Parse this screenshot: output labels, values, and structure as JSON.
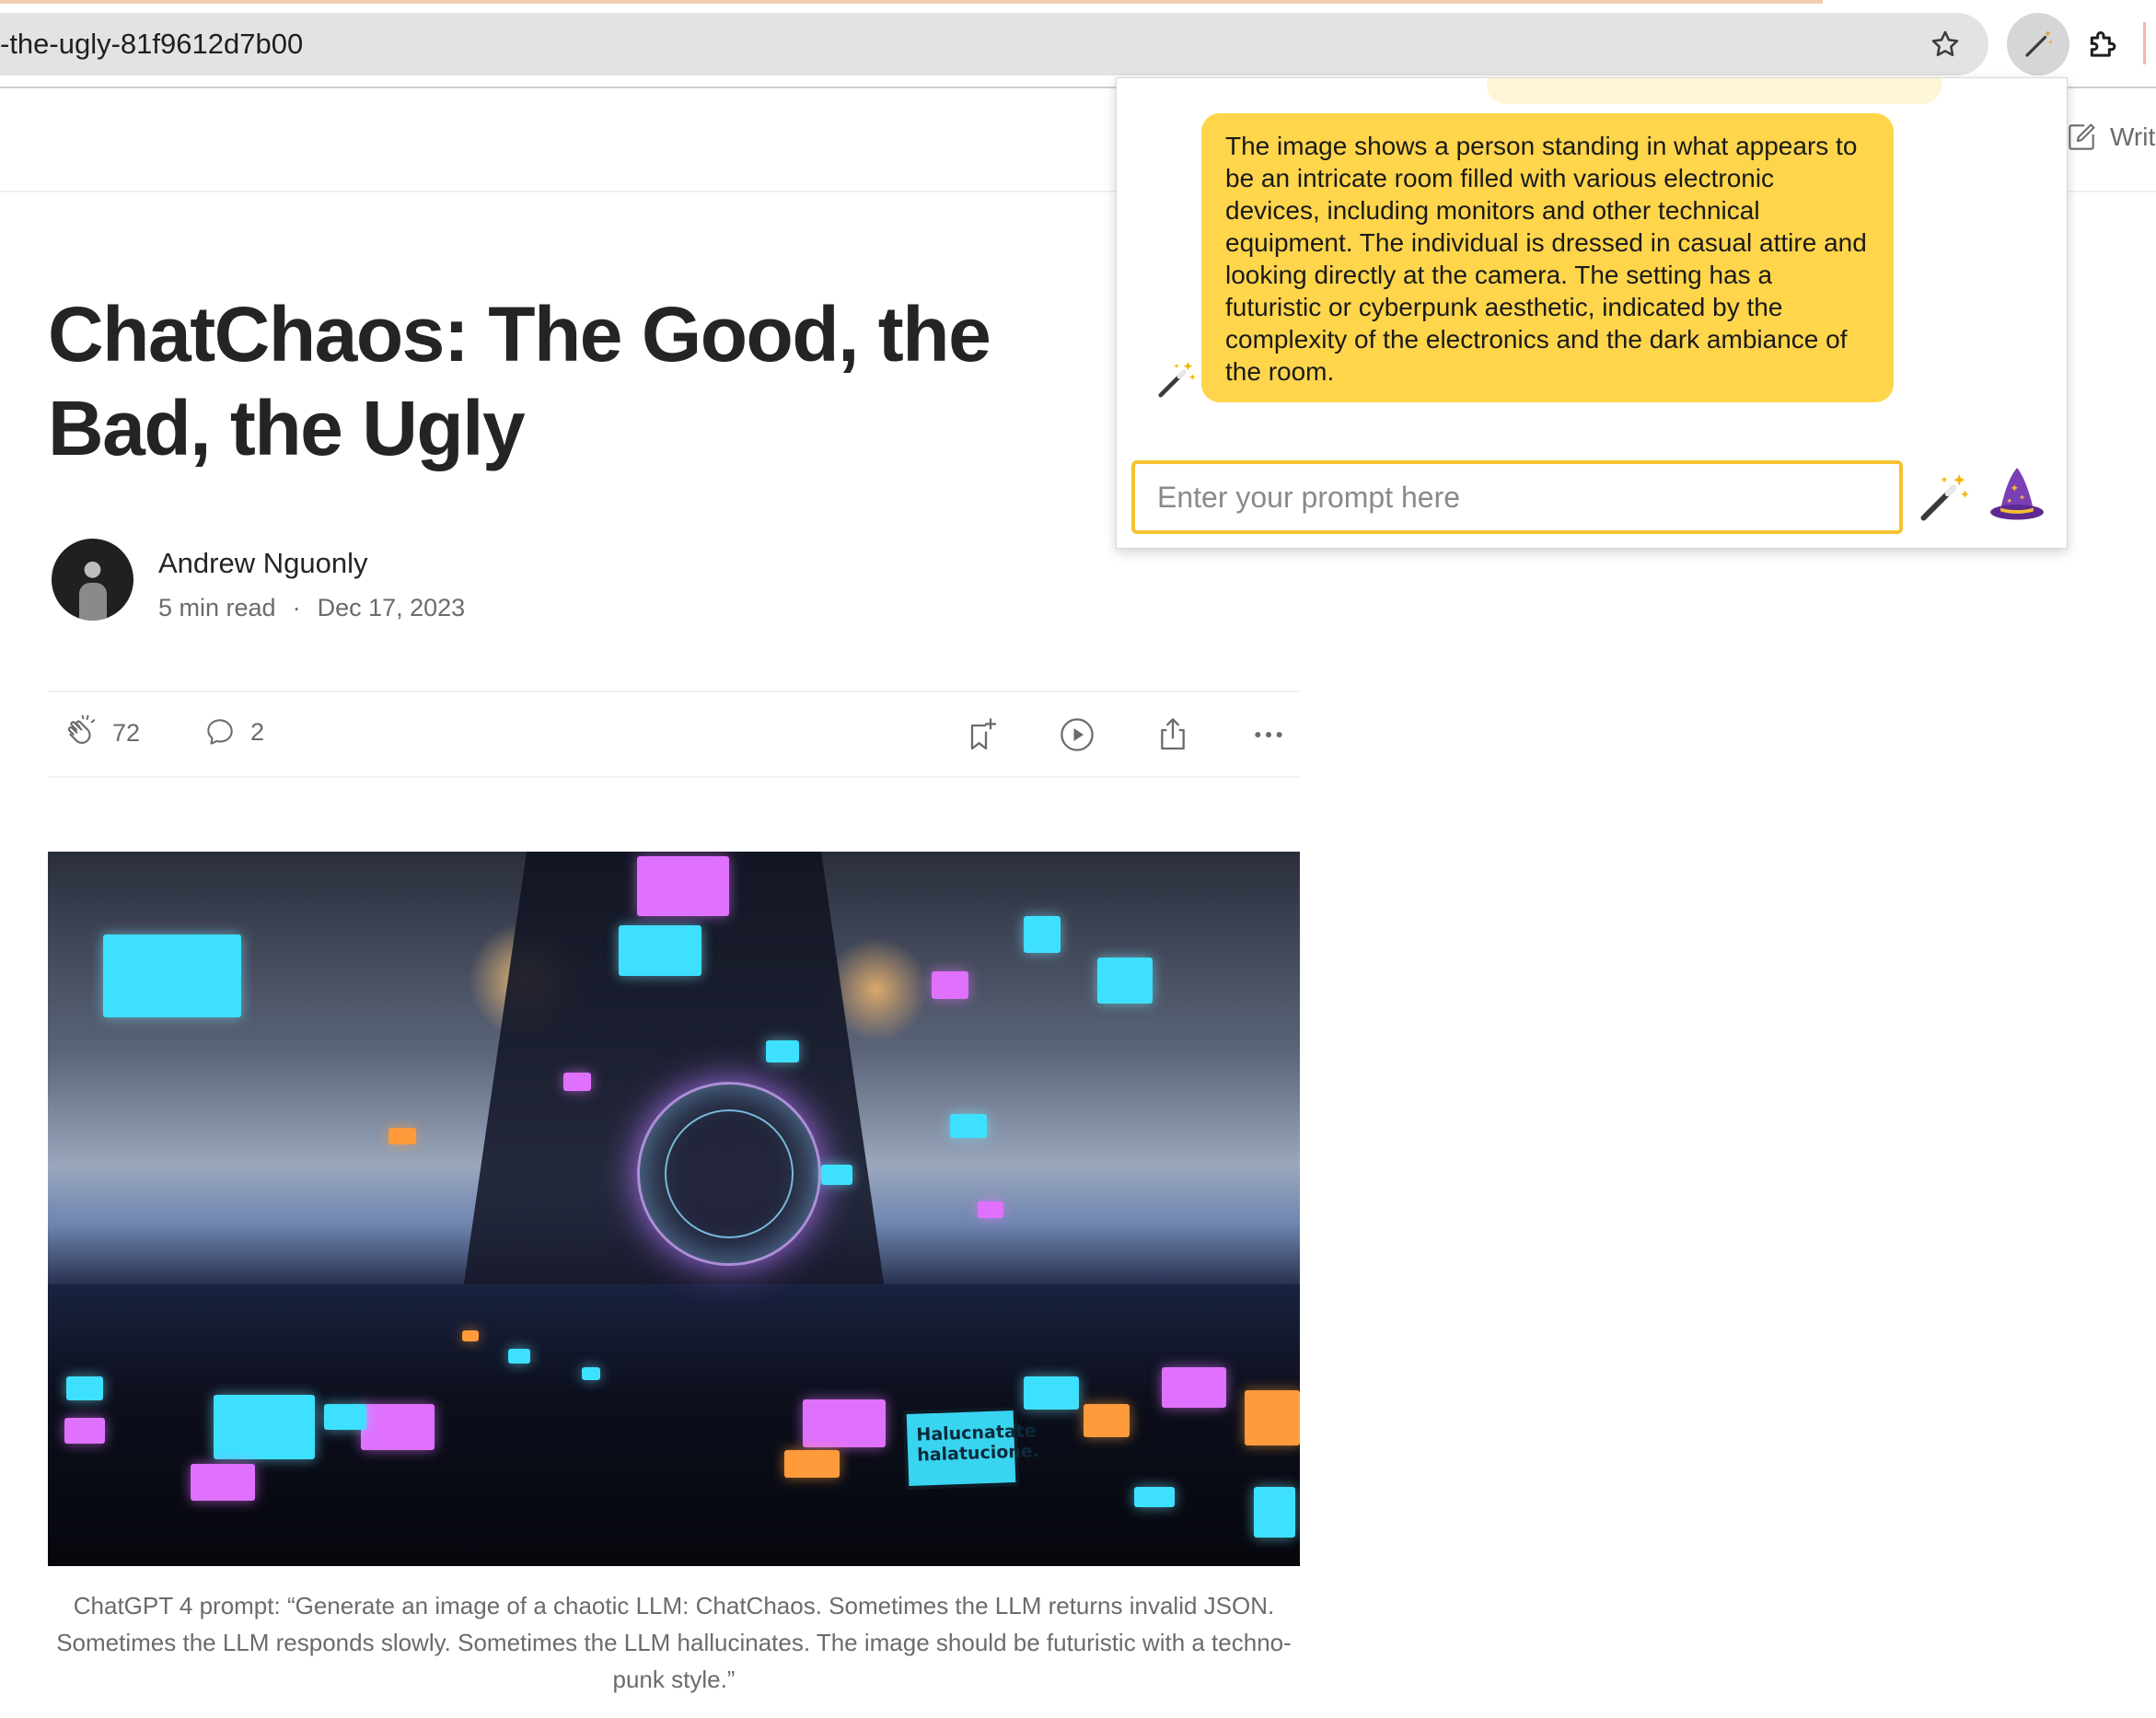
{
  "browser": {
    "url": "-the-ugly-81f9612d7b00",
    "icons": [
      "star-icon",
      "magic-wand-icon",
      "puzzle-icon"
    ]
  },
  "header": {
    "write_label": "Writ"
  },
  "article": {
    "title": "ChatChaos: The Good, the Bad, the Ugly",
    "author": "Andrew Nguonly",
    "read_time": "5 min read",
    "separator": "·",
    "date": "Dec 17, 2023",
    "claps": "72",
    "comments": "2",
    "image_caption": "ChatGPT 4 prompt: “Generate an image of a chaotic LLM: ChatChaos. Sometimes the LLM returns invalid JSON. Sometimes the LLM responds slowly. Sometimes the LLM hallucinates. The image should be futuristic with a techno-punk style.”",
    "image_sign_text": "Halucnatate halatucione."
  },
  "popup": {
    "response": " The image shows a person standing in what appears to be an intricate room filled with various electronic devices, including monitors and other technical equipment. The individual is dressed in casual attire and looking directly at the camera. The setting has a futuristic or cyberpunk aesthetic, indicated by the complexity of the electronics and the dark ambiance of the room.",
    "input_placeholder": "Enter your prompt here",
    "input_value": ""
  },
  "colors": {
    "bubble": "#ffd54b",
    "input_border": "#f6c231",
    "text": "#242424",
    "muted": "#6b6b6b"
  }
}
